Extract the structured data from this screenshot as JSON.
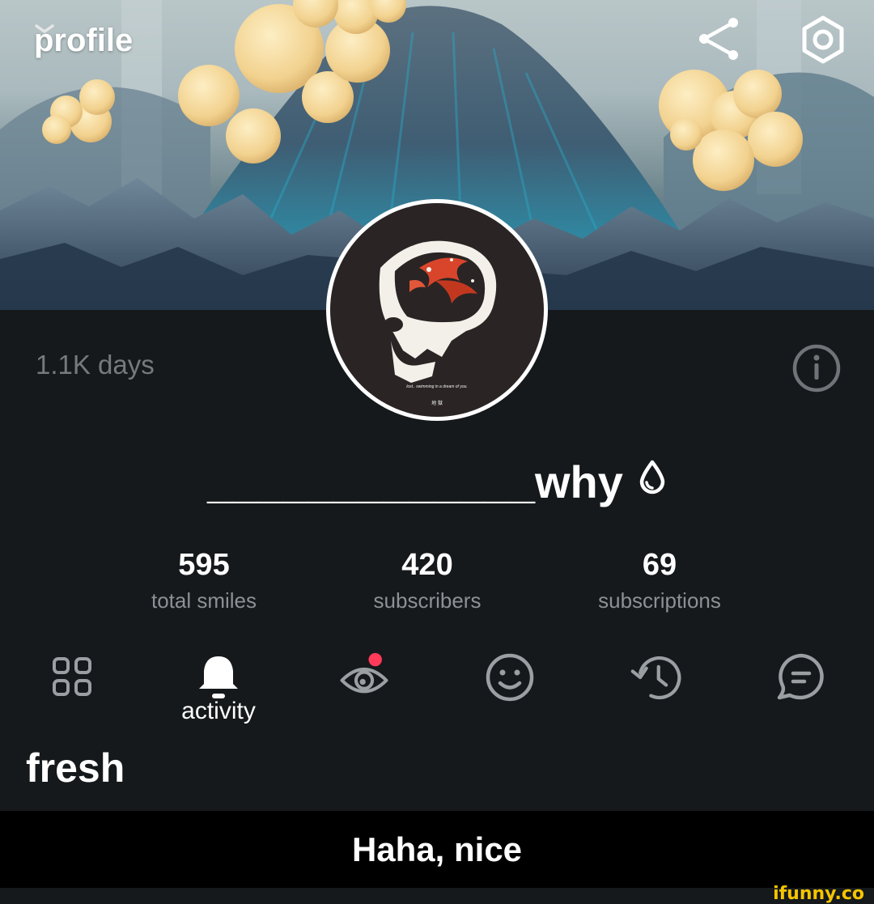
{
  "header": {
    "title": "profile",
    "dropdown_icon": "chevron-down-icon",
    "share_icon": "share-icon",
    "settings_icon": "hexagon-settings-icon"
  },
  "avatar": {
    "caption": "lost.. swimming in a dream of you.",
    "kanji": "地 獄"
  },
  "account_age": "1.1K days",
  "info_icon": "info-icon",
  "username": "_____________why",
  "username_badge_icon": "water-drop-icon",
  "stats": [
    {
      "value": "595",
      "label": "total smiles"
    },
    {
      "value": "420",
      "label": "subscribers"
    },
    {
      "value": "69",
      "label": "subscriptions"
    }
  ],
  "tabs": {
    "grid_icon": "grid-icon",
    "activity_icon": "bell-icon",
    "activity_label": "activity",
    "guests_icon": "eye-icon",
    "smiles_icon": "smiley-icon",
    "history_icon": "history-icon",
    "chat_icon": "chat-icon",
    "notification_dot_color": "#ff3a5a"
  },
  "section_title": "fresh",
  "caption": "Haha, nice",
  "watermark": "ifunny.co",
  "colors": {
    "background": "#15191b",
    "accent_dot": "#ff3a5a",
    "watermark": "#f5c400"
  }
}
